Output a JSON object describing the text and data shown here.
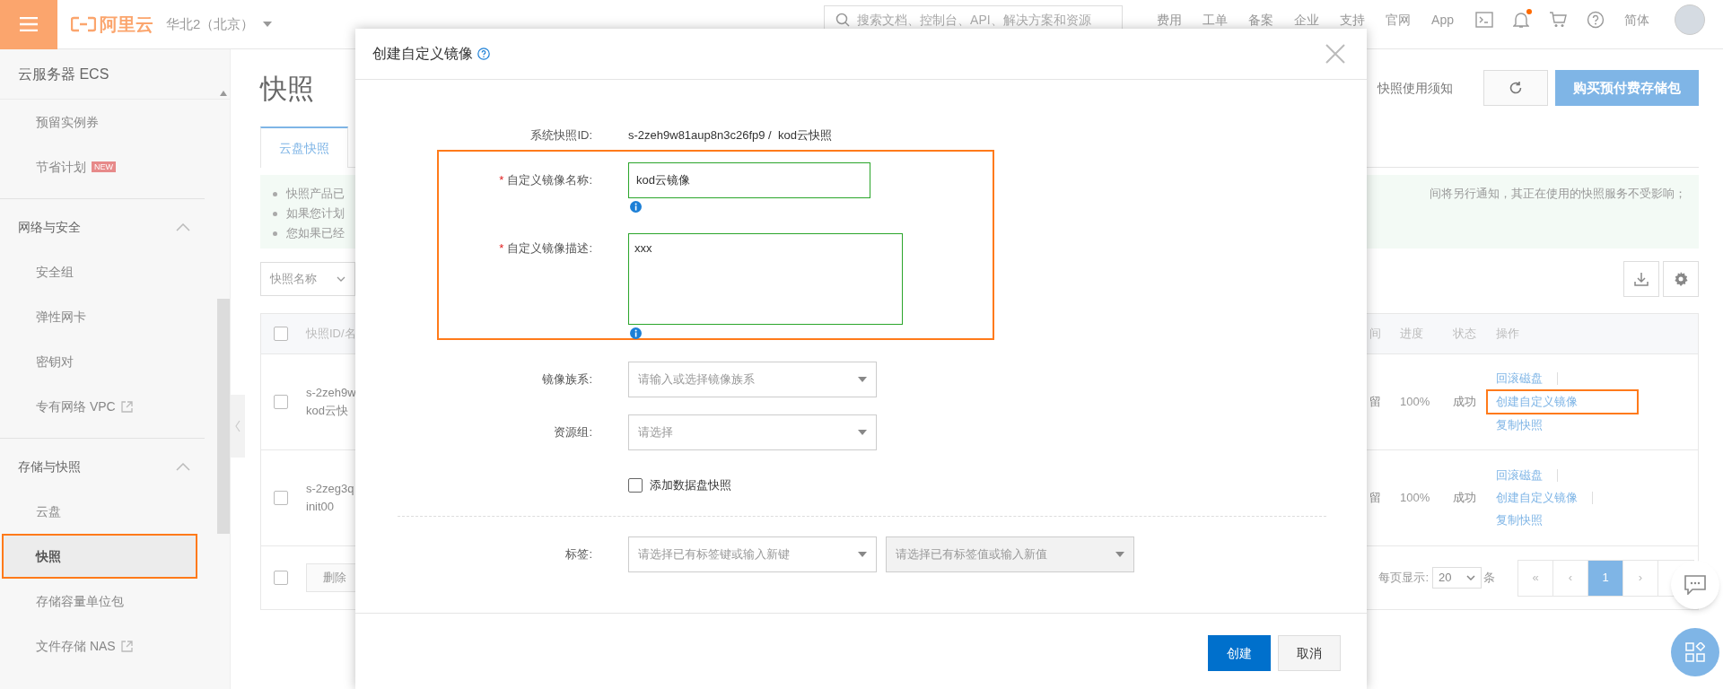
{
  "top_bar": {
    "logo": "阿里云",
    "region": "华北2（北京）",
    "search_placeholder": "搜索文档、控制台、API、解决方案和资源",
    "nav": [
      "费用",
      "工单",
      "备案",
      "企业",
      "支持",
      "官网",
      "App"
    ],
    "notification_dot": true,
    "language": "简体"
  },
  "sidebar": {
    "title": "云服务器 ECS",
    "sections": [
      {
        "items": [
          {
            "label": "预留实例券",
            "selected": false
          },
          {
            "label": "节省计划",
            "badge": "NEW",
            "selected": false
          }
        ]
      },
      {
        "title": "网络与安全",
        "expanded": true,
        "items": [
          {
            "label": "安全组",
            "selected": false
          },
          {
            "label": "弹性网卡",
            "selected": false
          },
          {
            "label": "密钥对",
            "selected": false
          },
          {
            "label": "专有网络 VPC",
            "external": true,
            "selected": false
          }
        ]
      },
      {
        "title": "存储与快照",
        "expanded": true,
        "items": [
          {
            "label": "云盘",
            "selected": false
          },
          {
            "label": "快照",
            "selected": true,
            "highlighted": true
          },
          {
            "label": "存储容量单位包",
            "selected": false
          },
          {
            "label": "文件存储 NAS",
            "external": true,
            "selected": false
          }
        ]
      }
    ]
  },
  "page": {
    "title": "快照",
    "notice_link": "快照使用须知",
    "buy_button": "购买预付费存储包",
    "tabs": [
      {
        "label": "云盘快照",
        "selected": true
      }
    ],
    "notice_left": [
      "快照产品已",
      "如果您计划",
      "您如果已经"
    ],
    "notice_right": [
      "间将另行通知，其正在使用的快照服务不受影响；"
    ],
    "filter": "快照名称",
    "table": {
      "column_left": "快照ID/名",
      "columns_right": [
        "间",
        "进度",
        "状态",
        "操作"
      ],
      "header_checked": false,
      "rows": [
        {
          "checked": false,
          "id": "s-2zeh9w",
          "name": "kod云快",
          "cell_right": "留",
          "progress": "100%",
          "status": "成功",
          "actions": [
            {
              "label": "回滚磁盘",
              "highlighted": false
            },
            {
              "label": "创建自定义镜像",
              "highlighted": true
            },
            {
              "label": "复制快照",
              "highlighted": false
            }
          ]
        },
        {
          "checked": false,
          "id": "s-2zeg3q",
          "name": "init00",
          "cell_right": "留",
          "progress": "100%",
          "status": "成功",
          "actions": [
            {
              "label": "回滚磁盘",
              "highlighted": false
            },
            {
              "label": "创建自定义镜像",
              "highlighted": false
            },
            {
              "label": "复制快照",
              "highlighted": false
            }
          ]
        }
      ],
      "footer_checked": false,
      "delete_button": "删除",
      "page_size_label": "每页显示:",
      "page_size": "20",
      "page_unit": "条",
      "pages": [
        {
          "label": "«",
          "selected": false
        },
        {
          "label": "‹",
          "selected": false
        },
        {
          "label": "1",
          "selected": true
        },
        {
          "label": "›",
          "selected": false
        }
      ]
    }
  },
  "dialog": {
    "title": "创建自定义镜像",
    "snapshot_label": "系统快照ID:",
    "snapshot_value": "s-2zeh9w81aup8n3c26fp9 /  kod云快照",
    "name_field": {
      "label": "自定义镜像名称:",
      "required_mark": "*",
      "value": "kod云镜像"
    },
    "description_field": {
      "label": "自定义镜像描述:",
      "required_mark": "*",
      "value": "xxx"
    },
    "family_field": {
      "label": "镜像族系:",
      "placeholder": "请输入或选择镜像族系"
    },
    "group_field": {
      "label": "资源组:",
      "placeholder": "请选择"
    },
    "data_disk": {
      "label": "添加数据盘快照",
      "checked": false
    },
    "tags": {
      "label": "标签:",
      "key_placeholder": "请选择已有标签键或输入新键",
      "value_placeholder": "请选择已有标签值或输入新值",
      "value_disabled": true
    },
    "buttons": [
      {
        "label": "创建",
        "kind": "primary"
      },
      {
        "label": "取消",
        "kind": "secondary"
      }
    ]
  }
}
